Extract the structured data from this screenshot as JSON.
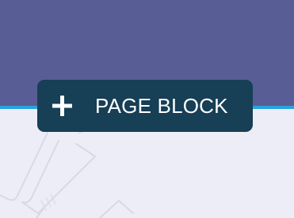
{
  "colors": {
    "header_background": "#585d96",
    "accent_line": "#2aa3e0",
    "canvas_background": "#ecedf6",
    "button_background": "#173f56",
    "button_text": "#ffffff"
  },
  "add_block_button": {
    "icon": "plus-icon",
    "label": "PAGE BLOCK"
  }
}
